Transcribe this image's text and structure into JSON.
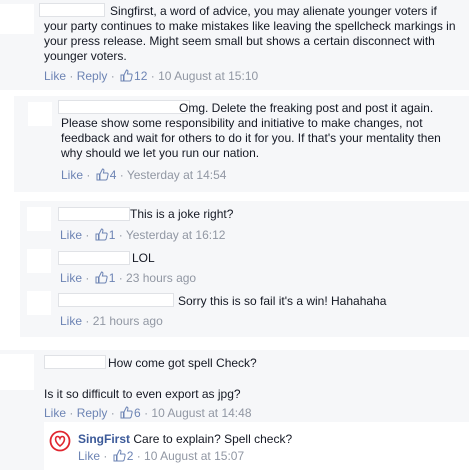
{
  "comments": [
    {
      "text": "Singfirst, a word of advice, you may alienate younger voters if your party continues to make mistakes like leaving the spellcheck markings in your press release. Might seem small but shows a certain disconnect with younger voters.",
      "like_label": "Like",
      "reply_label": "Reply",
      "likes": "12",
      "time": "10 August at 15:10"
    },
    {
      "text": "Omg. Delete the freaking post and post it again. Please show some responsibility and initiative to make changes, not feedback and wait for others to do it for you. If that's your mentality then why should we let you run our nation.",
      "like_label": "Like",
      "likes": "4",
      "time": "Yesterday at 14:54"
    },
    {
      "text": "This is a joke right?",
      "like_label": "Like",
      "likes": "1",
      "time": "Yesterday at 16:12"
    },
    {
      "text": "LOL",
      "like_label": "Like",
      "likes": "1",
      "time": "23 hours ago"
    },
    {
      "text": "Sorry this is so fail it's a win! Hahahaha",
      "like_label": "Like",
      "time": "21 hours ago"
    },
    {
      "text_line1": "How come got spell Check?",
      "text_line2": "Is it so difficult to even export as jpg?",
      "like_label": "Like",
      "reply_label": "Reply",
      "likes": "6",
      "time": "10 August at 14:48"
    },
    {
      "author": "SingFirst",
      "text": "Care to explain? Spell check?",
      "like_label": "Like",
      "likes": "2",
      "time": "10 August at 15:07"
    }
  ],
  "icons": {
    "like": "thumbs-up-icon",
    "page_logo": "heart-logo-icon"
  },
  "colors": {
    "link": "#6d84b4",
    "author": "#3b5998",
    "meta": "#9197a3",
    "logo": "#e0262f"
  }
}
